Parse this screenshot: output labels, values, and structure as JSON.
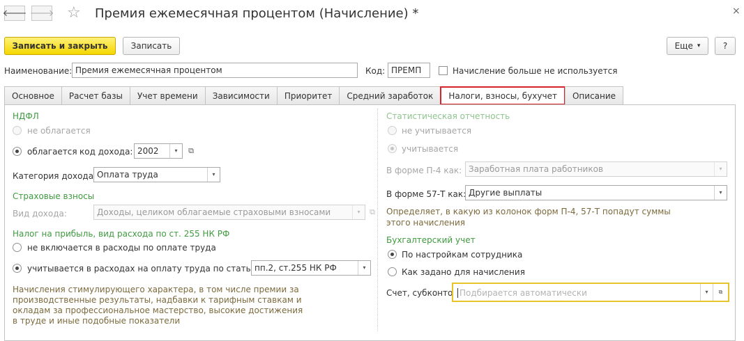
{
  "window": {
    "title": "Премия ежемесячная процентом (Начисление) *",
    "close": "×",
    "back": "🡐",
    "forward": "🡒",
    "star": "☆"
  },
  "toolbar": {
    "save_close": "Записать и закрыть",
    "save": "Записать",
    "more": "Еще",
    "more_arrow": "▾",
    "help": "?"
  },
  "header": {
    "name_label": "Наименование:",
    "name_value": "Премия ежемесячная процентом",
    "code_label": "Код:",
    "code_value": "ПРЕМП",
    "not_used_label": "Начисление больше не используется"
  },
  "tabs": [
    "Основное",
    "Расчет базы",
    "Учет времени",
    "Зависимости",
    "Приоритет",
    "Средний заработок",
    "Налоги, взносы, бухучет",
    "Описание"
  ],
  "left": {
    "ndfl_header": "НДФЛ",
    "not_taxed": "не облагается",
    "taxed": "облагается",
    "income_code_label": "код дохода:",
    "income_code_value": "2002",
    "category_label": "Категория дохода:",
    "category_value": "Оплата труда",
    "insurance_header": "Страховые взносы",
    "income_type_label": "Вид дохода:",
    "income_type_value": "Доходы, целиком облагаемые страховыми взносами",
    "profit_tax_header": "Налог на прибыль, вид расхода по ст. 255 НК РФ",
    "not_included": "не включается в расходы по оплате труда",
    "included": "учитывается в расходах на оплату труда по статье:",
    "article_value": "пп.2, ст.255 НК РФ",
    "note": [
      "Начисления стимулирующего характера, в том числе премии за",
      "производственные результаты, надбавки к тарифным ставкам и",
      "окладам за профессиональное мастерство, высокие достижения",
      "в труде и иные подобные показатели"
    ]
  },
  "right": {
    "stat_header": "Статистическая отчетность",
    "not_counted": "не учитывается",
    "counted": "учитывается",
    "p4_label": "В форме П-4 как:",
    "p4_value": "Заработная плата работников",
    "f57_label": "В форме 57-Т как:",
    "f57_value": "Другие выплаты",
    "stat_note": [
      "Определяет, в какую из колонок форм П-4, 57-Т попадут суммы",
      "этого начисления"
    ],
    "acc_header": "Бухгалтерский учет",
    "by_employee": "По настройкам сотрудника",
    "as_set": "Как задано для начисления",
    "account_label": "Счет, субконто:",
    "account_placeholder": "Подбирается автоматически"
  },
  "colors": {
    "accent_yellow": "#f4d600",
    "section_green": "#3f9b3f",
    "active_tab_border": "#d9232a",
    "focus_border": "#e8c42a",
    "note_brown": "#7c6a3c"
  },
  "icons": {
    "dropdown": "▾",
    "open": "⧉"
  }
}
